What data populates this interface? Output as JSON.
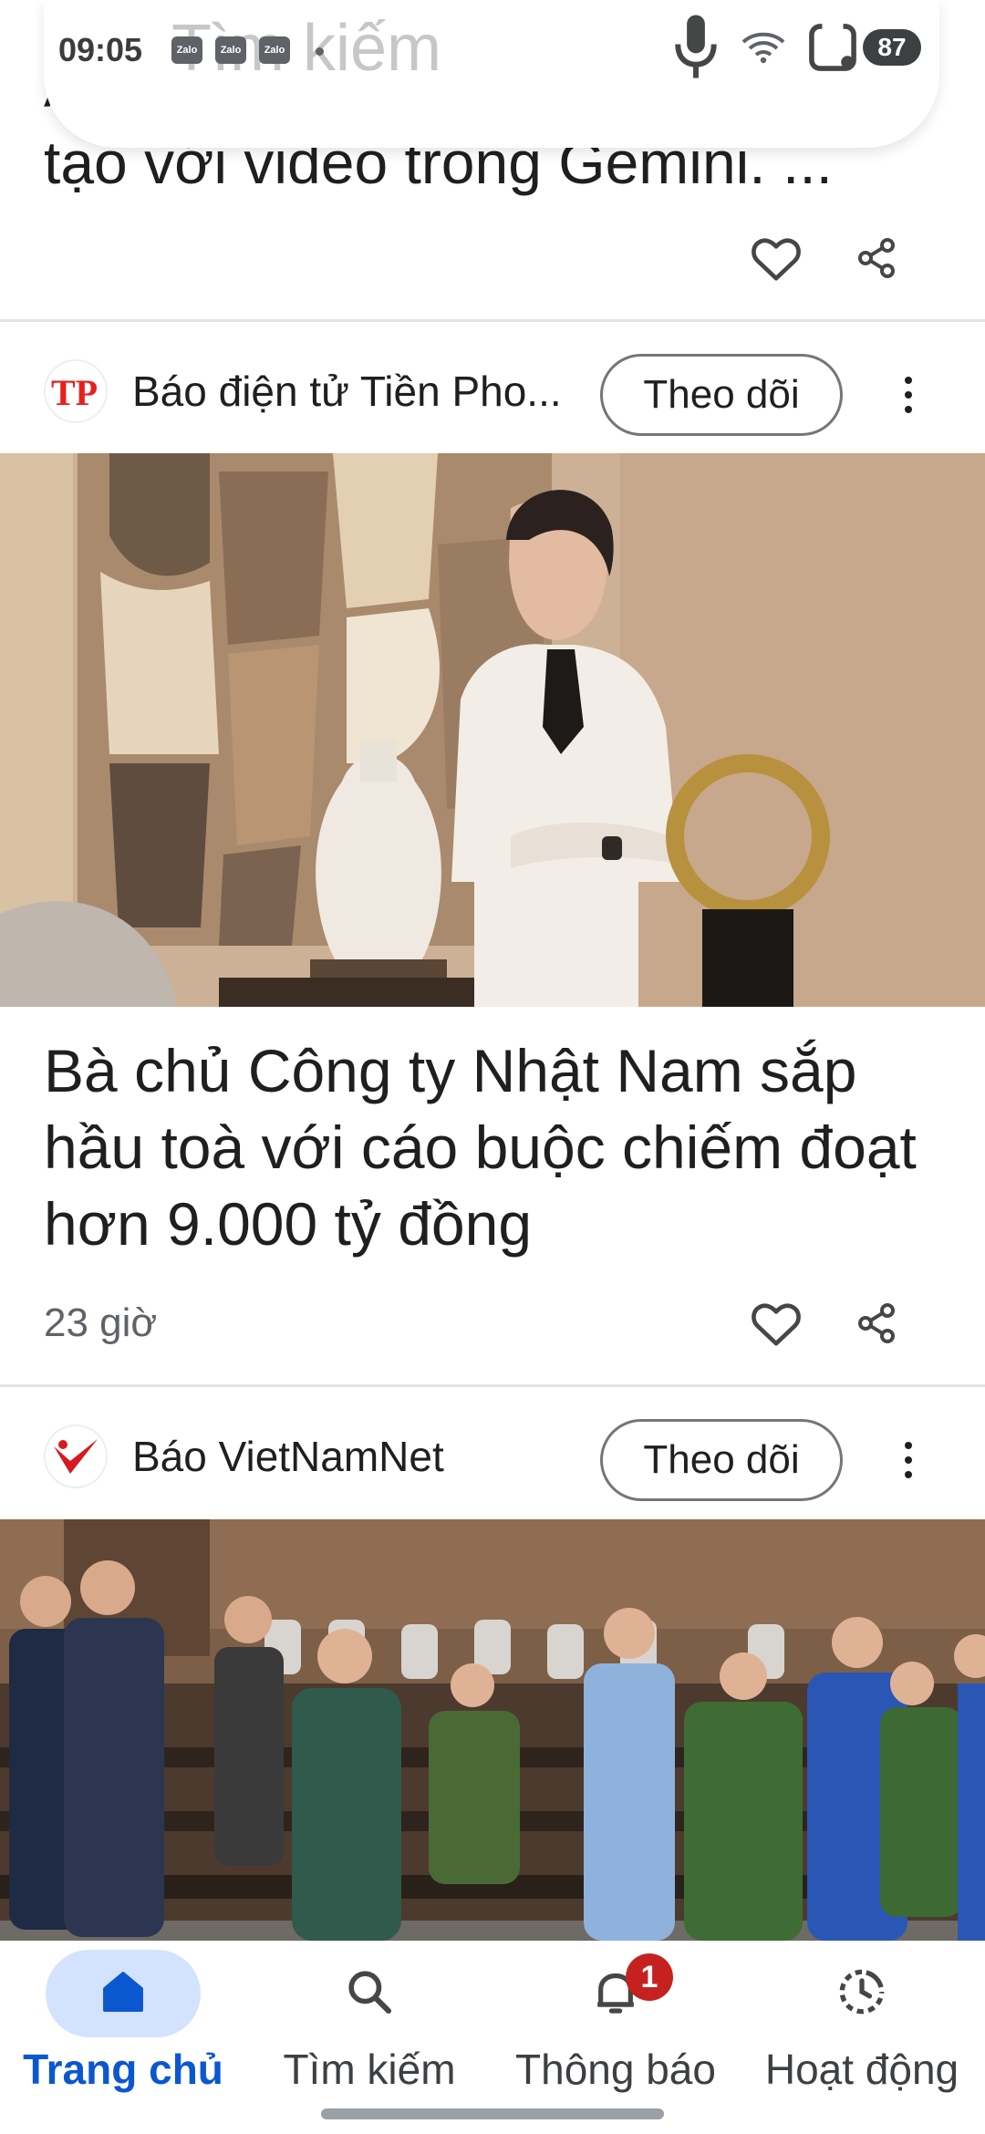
{
  "status_bar": {
    "time": "09:05",
    "notification_icons": [
      "Zalo",
      "Zalo",
      "Zalo"
    ],
    "battery": "87"
  },
  "search": {
    "placeholder": "Tìm kiếm"
  },
  "top_article": {
    "title_line1": "A",
    "title_line2": "tạo với video trong Gemini. ..."
  },
  "articles": [
    {
      "publisher": "Báo điện tử Tiền Pho...",
      "publisher_logo_text": "TP",
      "follow_label": "Theo dõi",
      "headline": "Bà chủ Công ty Nhật Nam sắp hầu toà với cáo buộc chiếm đoạt hơn 9.000 tỷ đồng",
      "time": "23 giờ"
    },
    {
      "publisher": "Báo VietNamNet",
      "follow_label": "Theo dõi"
    }
  ],
  "bottom_nav": {
    "items": [
      {
        "label": "Trang chủ",
        "icon": "home-icon",
        "active": true
      },
      {
        "label": "Tìm kiếm",
        "icon": "search-icon"
      },
      {
        "label": "Thông báo",
        "icon": "bell-icon",
        "badge": "1"
      },
      {
        "label": "Hoạt động",
        "icon": "activity-icon"
      }
    ]
  },
  "colors": {
    "accent": "#0b57d0",
    "nav_pill": "#d3e3fd",
    "badge": "#c5221f",
    "tp_red": "#e8201c",
    "vnn_red": "#d71920"
  }
}
